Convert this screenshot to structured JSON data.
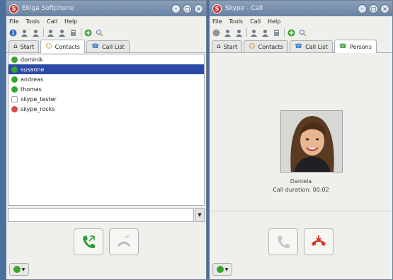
{
  "left_window": {
    "title": "Ekiga Softphone",
    "menu": [
      "File",
      "Tools",
      "Call",
      "Help"
    ],
    "tabs": [
      {
        "label": "Start",
        "icon": "home-icon"
      },
      {
        "label": "Contacts",
        "icon": "contacts-icon"
      },
      {
        "label": "Call List",
        "icon": "phone-icon"
      }
    ],
    "active_tab": 1,
    "contacts": [
      {
        "name": "dominik",
        "status": "online"
      },
      {
        "name": "susanne",
        "status": "online",
        "selected": true
      },
      {
        "name": "andreas",
        "status": "online"
      },
      {
        "name": "thomas",
        "status": "online"
      },
      {
        "name": "skype_tester",
        "status": "offline"
      },
      {
        "name": "skype_rocks",
        "status": "away"
      }
    ],
    "input_value": ""
  },
  "right_window": {
    "title": "Skype - Call",
    "menu": [
      "File",
      "Tools",
      "Call",
      "Help"
    ],
    "tabs": [
      {
        "label": "Start",
        "icon": "home-icon"
      },
      {
        "label": "Contacts",
        "icon": "contacts-icon"
      },
      {
        "label": "Call List",
        "icon": "phone-icon"
      },
      {
        "label": "Persons",
        "icon": "phone-active-icon"
      }
    ],
    "active_tab": 3,
    "callee": {
      "name": "Daniela",
      "status": "Call duration: 00:02"
    }
  },
  "colors": {
    "accept": "#2f9e36",
    "hangup": "#d23a2e",
    "selected": "#2b4aa6",
    "online": "#36a52e",
    "away": "#d94848"
  }
}
